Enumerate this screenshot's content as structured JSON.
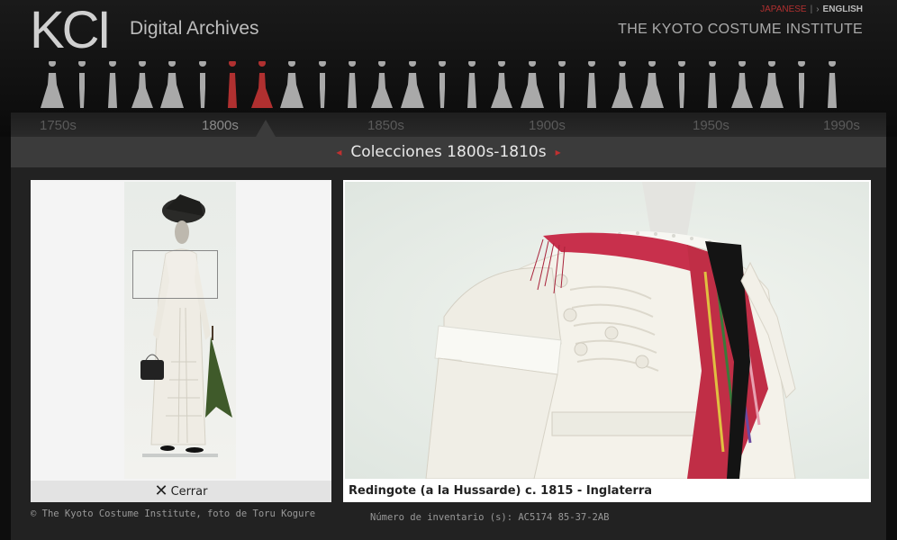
{
  "header": {
    "logo": "KCI",
    "subtitle": "Digital Archives",
    "lang_japanese": "JAPANESE",
    "lang_separator": "|",
    "lang_english": "ENGLISH",
    "institute": "THE KYOTO COSTUME INSTITUTE"
  },
  "timeline": {
    "eras": [
      "1750s",
      "1800s",
      "1850s",
      "1900s",
      "1950s",
      "1990s"
    ],
    "active_era": "1800s",
    "accent_color": "#b03030"
  },
  "collection": {
    "prev_arrow": "◂",
    "title": "Colecciones 1800s-1810s",
    "next_arrow": "▸"
  },
  "viewer": {
    "close_icon": "✕",
    "close_label": "Cerrar",
    "caption": "Redingote (a la Hussarde) c. 1815 - Inglaterra",
    "copyright": "© The Kyoto Costume Institute, foto de Toru Kogure",
    "inventory": "Número de inventario (s): AC5174 85-37-2AB"
  }
}
